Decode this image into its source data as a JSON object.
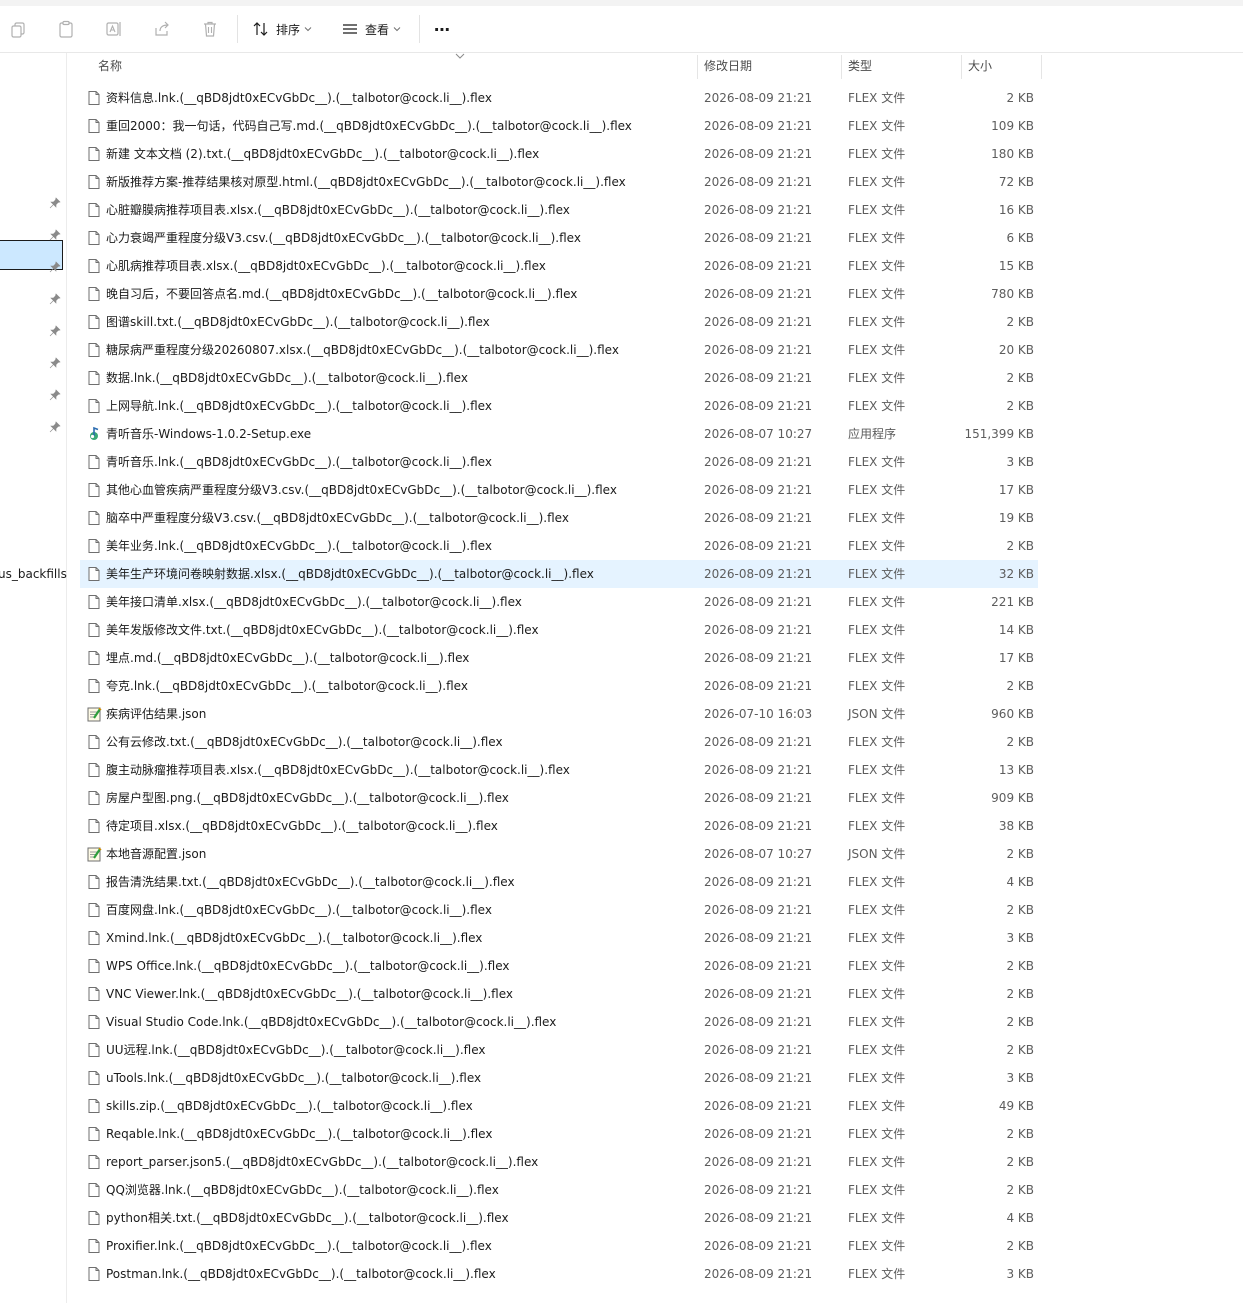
{
  "toolbar": {
    "sort_label": "排序",
    "view_label": "查看",
    "more_label": "⋯"
  },
  "left_pane": {
    "partial_label": "us_backfills"
  },
  "columns": {
    "name": "名称",
    "date": "修改日期",
    "type": "类型",
    "size": "大小"
  },
  "files": [
    {
      "name": "资料信息.lnk.(__qBD8jdt0xECvGbDc__).(__talbotor@cock.li__).flex",
      "date": "2026-08-09 21:21",
      "type": "FLEX 文件",
      "size": "2 KB",
      "icon": "file-icon"
    },
    {
      "name": "重回2000：我一句话，代码自己写.md.(__qBD8jdt0xECvGbDc__).(__talbotor@cock.li__).flex",
      "date": "2026-08-09 21:21",
      "type": "FLEX 文件",
      "size": "109 KB",
      "icon": "file-icon"
    },
    {
      "name": "新建 文本文档 (2).txt.(__qBD8jdt0xECvGbDc__).(__talbotor@cock.li__).flex",
      "date": "2026-08-09 21:21",
      "type": "FLEX 文件",
      "size": "180 KB",
      "icon": "file-icon"
    },
    {
      "name": "新版推荐方案-推荐结果核对原型.html.(__qBD8jdt0xECvGbDc__).(__talbotor@cock.li__).flex",
      "date": "2026-08-09 21:21",
      "type": "FLEX 文件",
      "size": "72 KB",
      "icon": "file-icon"
    },
    {
      "name": "心脏瓣膜病推荐项目表.xlsx.(__qBD8jdt0xECvGbDc__).(__talbotor@cock.li__).flex",
      "date": "2026-08-09 21:21",
      "type": "FLEX 文件",
      "size": "16 KB",
      "icon": "file-icon"
    },
    {
      "name": "心力衰竭严重程度分级V3.csv.(__qBD8jdt0xECvGbDc__).(__talbotor@cock.li__).flex",
      "date": "2026-08-09 21:21",
      "type": "FLEX 文件",
      "size": "6 KB",
      "icon": "file-icon"
    },
    {
      "name": "心肌病推荐项目表.xlsx.(__qBD8jdt0xECvGbDc__).(__talbotor@cock.li__).flex",
      "date": "2026-08-09 21:21",
      "type": "FLEX 文件",
      "size": "15 KB",
      "icon": "file-icon"
    },
    {
      "name": "晚自习后，不要回答点名.md.(__qBD8jdt0xECvGbDc__).(__talbotor@cock.li__).flex",
      "date": "2026-08-09 21:21",
      "type": "FLEX 文件",
      "size": "780 KB",
      "icon": "file-icon"
    },
    {
      "name": "图谱skill.txt.(__qBD8jdt0xECvGbDc__).(__talbotor@cock.li__).flex",
      "date": "2026-08-09 21:21",
      "type": "FLEX 文件",
      "size": "2 KB",
      "icon": "file-icon"
    },
    {
      "name": "糖尿病严重程度分级20260807.xlsx.(__qBD8jdt0xECvGbDc__).(__talbotor@cock.li__).flex",
      "date": "2026-08-09 21:21",
      "type": "FLEX 文件",
      "size": "20 KB",
      "icon": "file-icon"
    },
    {
      "name": "数据.lnk.(__qBD8jdt0xECvGbDc__).(__talbotor@cock.li__).flex",
      "date": "2026-08-09 21:21",
      "type": "FLEX 文件",
      "size": "2 KB",
      "icon": "file-icon"
    },
    {
      "name": "上网导航.lnk.(__qBD8jdt0xECvGbDc__).(__talbotor@cock.li__).flex",
      "date": "2026-08-09 21:21",
      "type": "FLEX 文件",
      "size": "2 KB",
      "icon": "file-icon"
    },
    {
      "name": "青听音乐-Windows-1.0.2-Setup.exe",
      "date": "2026-08-07 10:27",
      "type": "应用程序",
      "size": "151,399 KB",
      "icon": "exe-icon"
    },
    {
      "name": "青听音乐.lnk.(__qBD8jdt0xECvGbDc__).(__talbotor@cock.li__).flex",
      "date": "2026-08-09 21:21",
      "type": "FLEX 文件",
      "size": "3 KB",
      "icon": "file-icon"
    },
    {
      "name": "其他心血管疾病严重程度分级V3.csv.(__qBD8jdt0xECvGbDc__).(__talbotor@cock.li__).flex",
      "date": "2026-08-09 21:21",
      "type": "FLEX 文件",
      "size": "17 KB",
      "icon": "file-icon"
    },
    {
      "name": "脑卒中严重程度分级V3.csv.(__qBD8jdt0xECvGbDc__).(__talbotor@cock.li__).flex",
      "date": "2026-08-09 21:21",
      "type": "FLEX 文件",
      "size": "19 KB",
      "icon": "file-icon"
    },
    {
      "name": "美年业务.lnk.(__qBD8jdt0xECvGbDc__).(__talbotor@cock.li__).flex",
      "date": "2026-08-09 21:21",
      "type": "FLEX 文件",
      "size": "2 KB",
      "icon": "file-icon"
    },
    {
      "name": "美年生产环境问卷映射数据.xlsx.(__qBD8jdt0xECvGbDc__).(__talbotor@cock.li__).flex",
      "date": "2026-08-09 21:21",
      "type": "FLEX 文件",
      "size": "32 KB",
      "icon": "file-icon",
      "selected": true
    },
    {
      "name": "美年接口清单.xlsx.(__qBD8jdt0xECvGbDc__).(__talbotor@cock.li__).flex",
      "date": "2026-08-09 21:21",
      "type": "FLEX 文件",
      "size": "221 KB",
      "icon": "file-icon"
    },
    {
      "name": "美年发版修改文件.txt.(__qBD8jdt0xECvGbDc__).(__talbotor@cock.li__).flex",
      "date": "2026-08-09 21:21",
      "type": "FLEX 文件",
      "size": "14 KB",
      "icon": "file-icon"
    },
    {
      "name": "埋点.md.(__qBD8jdt0xECvGbDc__).(__talbotor@cock.li__).flex",
      "date": "2026-08-09 21:21",
      "type": "FLEX 文件",
      "size": "17 KB",
      "icon": "file-icon"
    },
    {
      "name": "夸克.lnk.(__qBD8jdt0xECvGbDc__).(__talbotor@cock.li__).flex",
      "date": "2026-08-09 21:21",
      "type": "FLEX 文件",
      "size": "2 KB",
      "icon": "file-icon"
    },
    {
      "name": "疾病评估结果.json",
      "date": "2026-07-10 16:03",
      "type": "JSON 文件",
      "size": "960 KB",
      "icon": "json-icon"
    },
    {
      "name": "公有云修改.txt.(__qBD8jdt0xECvGbDc__).(__talbotor@cock.li__).flex",
      "date": "2026-08-09 21:21",
      "type": "FLEX 文件",
      "size": "2 KB",
      "icon": "file-icon"
    },
    {
      "name": "腹主动脉瘤推荐项目表.xlsx.(__qBD8jdt0xECvGbDc__).(__talbotor@cock.li__).flex",
      "date": "2026-08-09 21:21",
      "type": "FLEX 文件",
      "size": "13 KB",
      "icon": "file-icon"
    },
    {
      "name": "房屋户型图.png.(__qBD8jdt0xECvGbDc__).(__talbotor@cock.li__).flex",
      "date": "2026-08-09 21:21",
      "type": "FLEX 文件",
      "size": "909 KB",
      "icon": "file-icon"
    },
    {
      "name": "待定项目.xlsx.(__qBD8jdt0xECvGbDc__).(__talbotor@cock.li__).flex",
      "date": "2026-08-09 21:21",
      "type": "FLEX 文件",
      "size": "38 KB",
      "icon": "file-icon"
    },
    {
      "name": "本地音源配置.json",
      "date": "2026-08-07 10:27",
      "type": "JSON 文件",
      "size": "2 KB",
      "icon": "json-icon"
    },
    {
      "name": "报告清洗结果.txt.(__qBD8jdt0xECvGbDc__).(__talbotor@cock.li__).flex",
      "date": "2026-08-09 21:21",
      "type": "FLEX 文件",
      "size": "4 KB",
      "icon": "file-icon"
    },
    {
      "name": "百度网盘.lnk.(__qBD8jdt0xECvGbDc__).(__talbotor@cock.li__).flex",
      "date": "2026-08-09 21:21",
      "type": "FLEX 文件",
      "size": "2 KB",
      "icon": "file-icon"
    },
    {
      "name": "Xmind.lnk.(__qBD8jdt0xECvGbDc__).(__talbotor@cock.li__).flex",
      "date": "2026-08-09 21:21",
      "type": "FLEX 文件",
      "size": "3 KB",
      "icon": "file-icon"
    },
    {
      "name": "WPS Office.lnk.(__qBD8jdt0xECvGbDc__).(__talbotor@cock.li__).flex",
      "date": "2026-08-09 21:21",
      "type": "FLEX 文件",
      "size": "2 KB",
      "icon": "file-icon"
    },
    {
      "name": "VNC Viewer.lnk.(__qBD8jdt0xECvGbDc__).(__talbotor@cock.li__).flex",
      "date": "2026-08-09 21:21",
      "type": "FLEX 文件",
      "size": "2 KB",
      "icon": "file-icon"
    },
    {
      "name": "Visual Studio Code.lnk.(__qBD8jdt0xECvGbDc__).(__talbotor@cock.li__).flex",
      "date": "2026-08-09 21:21",
      "type": "FLEX 文件",
      "size": "2 KB",
      "icon": "file-icon"
    },
    {
      "name": "UU远程.lnk.(__qBD8jdt0xECvGbDc__).(__talbotor@cock.li__).flex",
      "date": "2026-08-09 21:21",
      "type": "FLEX 文件",
      "size": "2 KB",
      "icon": "file-icon"
    },
    {
      "name": "uTools.lnk.(__qBD8jdt0xECvGbDc__).(__talbotor@cock.li__).flex",
      "date": "2026-08-09 21:21",
      "type": "FLEX 文件",
      "size": "3 KB",
      "icon": "file-icon"
    },
    {
      "name": "skills.zip.(__qBD8jdt0xECvGbDc__).(__talbotor@cock.li__).flex",
      "date": "2026-08-09 21:21",
      "type": "FLEX 文件",
      "size": "49 KB",
      "icon": "file-icon"
    },
    {
      "name": "Reqable.lnk.(__qBD8jdt0xECvGbDc__).(__talbotor@cock.li__).flex",
      "date": "2026-08-09 21:21",
      "type": "FLEX 文件",
      "size": "2 KB",
      "icon": "file-icon"
    },
    {
      "name": "report_parser.json5.(__qBD8jdt0xECvGbDc__).(__talbotor@cock.li__).flex",
      "date": "2026-08-09 21:21",
      "type": "FLEX 文件",
      "size": "2 KB",
      "icon": "file-icon"
    },
    {
      "name": "QQ浏览器.lnk.(__qBD8jdt0xECvGbDc__).(__talbotor@cock.li__).flex",
      "date": "2026-08-09 21:21",
      "type": "FLEX 文件",
      "size": "2 KB",
      "icon": "file-icon"
    },
    {
      "name": "python相关.txt.(__qBD8jdt0xECvGbDc__).(__talbotor@cock.li__).flex",
      "date": "2026-08-09 21:21",
      "type": "FLEX 文件",
      "size": "4 KB",
      "icon": "file-icon"
    },
    {
      "name": "Proxifier.lnk.(__qBD8jdt0xECvGbDc__).(__talbotor@cock.li__).flex",
      "date": "2026-08-09 21:21",
      "type": "FLEX 文件",
      "size": "2 KB",
      "icon": "file-icon"
    },
    {
      "name": "Postman.lnk.(__qBD8jdt0xECvGbDc__).(__talbotor@cock.li__).flex",
      "date": "2026-08-09 21:21",
      "type": "FLEX 文件",
      "size": "3 KB",
      "icon": "file-icon"
    }
  ],
  "colors": {
    "selection": "#e5f3ff",
    "pane_selection": "#cce8ff",
    "header_text": "#4c4c4c",
    "secondary_text": "#5c5c5c"
  }
}
